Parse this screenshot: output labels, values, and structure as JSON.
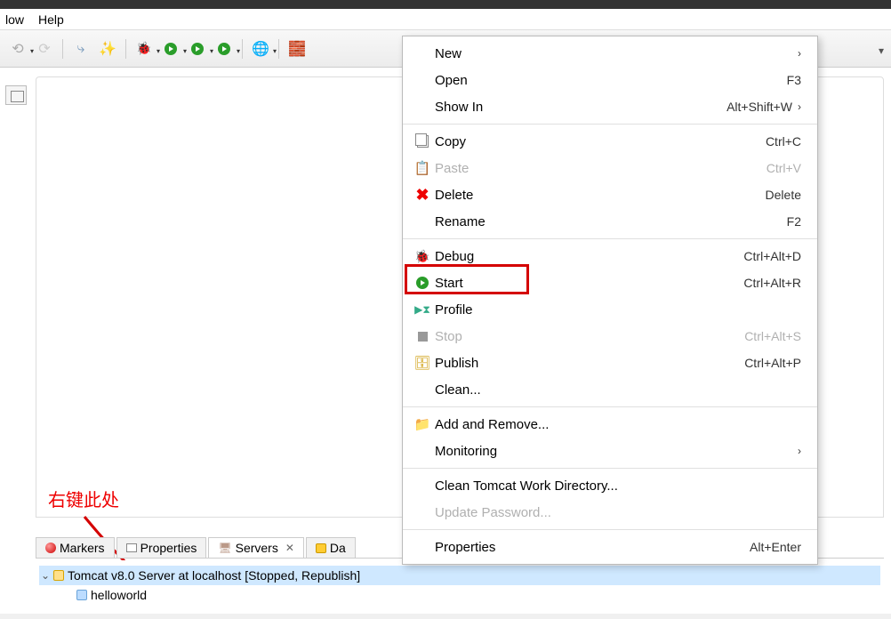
{
  "menubar": {
    "items": [
      "low",
      "Help"
    ]
  },
  "annotation": "右键此处",
  "tabs": {
    "markers": "Markers",
    "properties": "Properties",
    "servers": "Servers",
    "data": "Da"
  },
  "server_tree": {
    "root": "Tomcat v8.0 Server at localhost  [Stopped, Republish]",
    "child": "helloworld"
  },
  "context_menu": {
    "new": {
      "label": "New"
    },
    "open": {
      "label": "Open",
      "accel": "F3"
    },
    "show_in": {
      "label": "Show In",
      "accel": "Alt+Shift+W"
    },
    "copy": {
      "label": "Copy",
      "accel": "Ctrl+C"
    },
    "paste": {
      "label": "Paste",
      "accel": "Ctrl+V"
    },
    "delete": {
      "label": "Delete",
      "accel": "Delete"
    },
    "rename": {
      "label": "Rename",
      "accel": "F2"
    },
    "debug": {
      "label": "Debug",
      "accel": "Ctrl+Alt+D"
    },
    "start": {
      "label": "Start",
      "accel": "Ctrl+Alt+R"
    },
    "profile": {
      "label": "Profile"
    },
    "stop": {
      "label": "Stop",
      "accel": "Ctrl+Alt+S"
    },
    "publish": {
      "label": "Publish",
      "accel": "Ctrl+Alt+P"
    },
    "clean": {
      "label": "Clean..."
    },
    "add_remove": {
      "label": "Add and Remove..."
    },
    "monitoring": {
      "label": "Monitoring"
    },
    "clean_tomcat": {
      "label": "Clean Tomcat Work Directory..."
    },
    "update_pw": {
      "label": "Update Password..."
    },
    "properties": {
      "label": "Properties",
      "accel": "Alt+Enter"
    }
  }
}
